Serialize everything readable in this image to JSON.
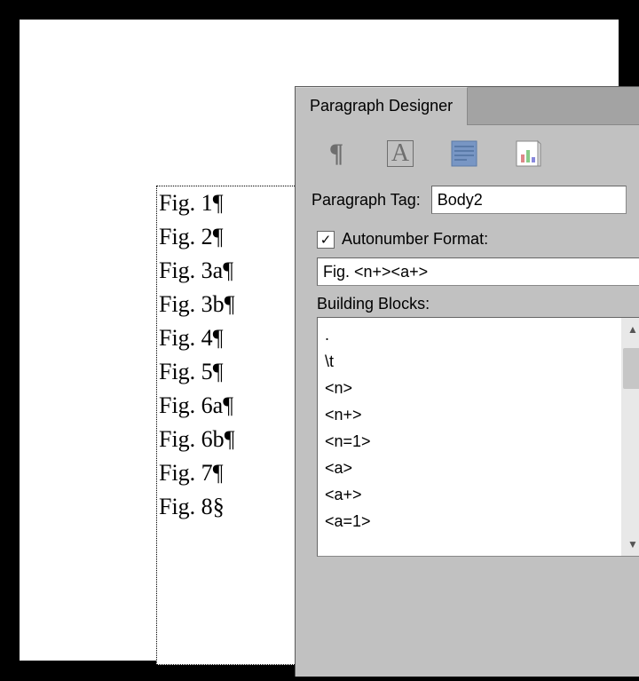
{
  "panel": {
    "tab_label": "Paragraph Designer",
    "paragraph_tag_label": "Paragraph Tag:",
    "paragraph_tag_value": "Body2",
    "autonumber_label": "Autonumber Format:",
    "autonumber_checked": true,
    "autonumber_format_value": "Fig. <n+><a+>",
    "building_blocks_label": "Building Blocks:",
    "building_blocks": [
      ".",
      "\\t",
      "<n>",
      "<n+>",
      "<n=1>",
      "<a>",
      "<a+>",
      "<a=1>"
    ]
  },
  "document": {
    "lines": [
      {
        "text": "Fig. 1",
        "mark": "¶"
      },
      {
        "text": "Fig. 2",
        "mark": "¶"
      },
      {
        "text": "Fig. 3a",
        "mark": "¶"
      },
      {
        "text": "Fig. 3b",
        "mark": "¶"
      },
      {
        "text": "Fig. 4",
        "mark": "¶"
      },
      {
        "text": "Fig. 5",
        "mark": "¶"
      },
      {
        "text": "Fig. 6a",
        "mark": "¶"
      },
      {
        "text": "Fig. 6b",
        "mark": "¶"
      },
      {
        "text": "Fig. 7",
        "mark": "¶"
      },
      {
        "text": "Fig. 8",
        "mark": "§"
      }
    ]
  },
  "icons": {
    "pilcrow": "¶",
    "font": "A",
    "check": "✓",
    "up": "▲",
    "down": "▼"
  }
}
